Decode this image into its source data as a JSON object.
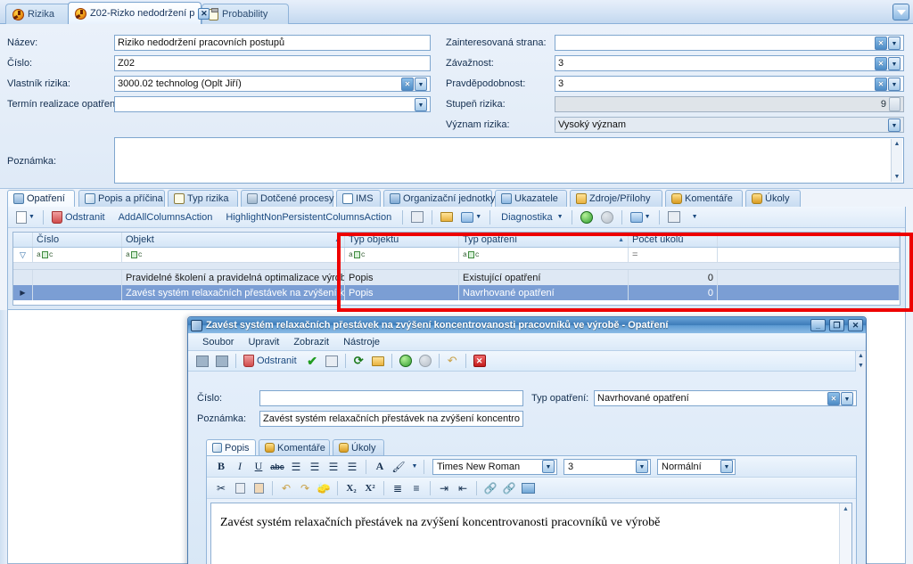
{
  "document_tabs": [
    {
      "label": "Rizika",
      "icon": "radiation-icon",
      "active": false,
      "closable": false
    },
    {
      "label": "Z02-Rizko nedodržení p",
      "icon": "radiation-icon",
      "active": true,
      "closable": true
    },
    {
      "label": "Probability",
      "icon": "clipboard-icon",
      "active": false,
      "closable": false
    }
  ],
  "form": {
    "left_fields": [
      {
        "label": "Název:",
        "value": "Riziko nedodržení pracovních postupů",
        "clear": false,
        "dropdown": false
      },
      {
        "label": "Číslo:",
        "value": "Z02",
        "clear": false,
        "dropdown": false
      },
      {
        "label": "Vlastník rizika:",
        "value": "3000.02 technolog (Oplt Jiří)",
        "clear": true,
        "dropdown": true
      },
      {
        "label": "Termín realizace opatření:",
        "value": "",
        "clear": false,
        "dropdown": true
      }
    ],
    "right_fields": [
      {
        "label": "Zainteresovaná strana:",
        "value": "",
        "clear": true,
        "dropdown": true,
        "readonly": false
      },
      {
        "label": "Závažnost:",
        "value": "3",
        "clear": true,
        "dropdown": true,
        "readonly": false
      },
      {
        "label": "Pravděpodobnost:",
        "value": "3",
        "clear": true,
        "dropdown": true,
        "readonly": false
      },
      {
        "label": "Stupeň rizika:",
        "value": "9",
        "spinner": true,
        "readonly": true
      },
      {
        "label": "Význam rizika:",
        "value": "Vysoký význam",
        "dropdown": true,
        "readonly": true
      }
    ],
    "note_label": "Poznámka:",
    "note_value": ""
  },
  "inner_tabs": [
    {
      "label": "Opatření",
      "icon": "measures-icon",
      "active": true
    },
    {
      "label": "Popis a příčina",
      "icon": "pencil-icon",
      "active": false
    },
    {
      "label": "Typ rizika",
      "icon": "clipboard-icon",
      "active": false
    },
    {
      "label": "Dotčené procesy",
      "icon": "process-icon",
      "active": false
    },
    {
      "label": "IMS",
      "icon": "checkbox-icon",
      "active": false
    },
    {
      "label": "Organizační jednotky",
      "icon": "people-icon",
      "active": false
    },
    {
      "label": "Ukazatele",
      "icon": "gauge-icon",
      "active": false
    },
    {
      "label": "Zdroje/Přílohy",
      "icon": "folder-icon",
      "active": false
    },
    {
      "label": "Komentáře",
      "icon": "comment-icon",
      "active": false
    },
    {
      "label": "Úkoly",
      "icon": "task-icon",
      "active": false
    }
  ],
  "grid_toolbar": {
    "new_label": "",
    "delete_label": "Odstranit",
    "add_all_columns_label": "AddAllColumnsAction",
    "highlight_label": "HighlightNonPersistentColumnsAction",
    "diagnostics_label": "Diagnostika"
  },
  "grid": {
    "columns": [
      "Číslo",
      "Objekt",
      "Typ objektu",
      "Typ opatření",
      "Počet úkolů"
    ],
    "sorted_columns": [
      "Objekt",
      "Typ opatření"
    ],
    "filter_row": [
      "aBc",
      "aBc",
      "aBc",
      "aBc",
      "="
    ],
    "rows": [
      {
        "selected": false,
        "cells": [
          "",
          "Pravidelné školení a pravidelná optimalizace výrobních ...",
          "Popis",
          "Existující opatření",
          "0"
        ]
      },
      {
        "selected": true,
        "cells": [
          "",
          "Zavést systém relaxačních přestávek na zvýšení kon ...",
          "Popis",
          "Navrhované opatření",
          "0"
        ]
      }
    ]
  },
  "dialog": {
    "title": "Zavést systém relaxačních přestávek na zvýšení koncentrovanosti pracovníků ve výrobě - Opatření",
    "window_buttons": [
      "minimize",
      "maximize",
      "close"
    ],
    "menu": [
      "Soubor",
      "Upravit",
      "Zobrazit",
      "Nástroje"
    ],
    "toolbar": {
      "delete_label": "Odstranit"
    },
    "fields": {
      "cislo_label": "Číslo:",
      "cislo_value": "",
      "poznamka_label": "Poznámka:",
      "poznamka_value": "Zavést systém relaxačních přestávek na zvýšení koncentrovanost",
      "typ_label": "Typ opatření:",
      "typ_value": "Navrhované opatření"
    },
    "editor_tabs": [
      {
        "label": "Popis",
        "icon": "pencil-icon",
        "active": true
      },
      {
        "label": "Komentáře",
        "icon": "comment-icon",
        "active": false
      },
      {
        "label": "Úkoly",
        "icon": "task-icon",
        "active": false
      }
    ],
    "format_toolbar": {
      "bold": "B",
      "italic": "I",
      "underline": "U",
      "strike": "abc",
      "align_left": "align-left-icon",
      "align_center": "align-center-icon",
      "align_right": "align-right-icon",
      "align_justify": "align-justify-icon",
      "font_color": "A",
      "highlight": "highlight-icon",
      "font_family": "Times New Roman",
      "font_size": "3",
      "style": "Normální"
    },
    "format_toolbar2": {
      "cut": "cut-icon",
      "copy": "copy-icon",
      "paste": "paste-icon",
      "undo": "undo-icon",
      "redo": "redo-icon",
      "erase": "erase-icon",
      "subscript": "X₂",
      "superscript": "X²",
      "ordered_list": "ordered-list-icon",
      "bullet_list": "bullet-list-icon",
      "indent": "indent-icon",
      "outdent": "outdent-icon",
      "link": "link-icon",
      "unlink": "unlink-icon",
      "image": "image-icon"
    },
    "editor_text": "Zavést systém relaxačních přestávek na zvýšení koncentrovanosti pracovníků ve výrobě"
  },
  "colors": {
    "highlight_rect": "#ee0000",
    "selection": "#7b9ed4",
    "title_bar": "#3d7cb9"
  }
}
